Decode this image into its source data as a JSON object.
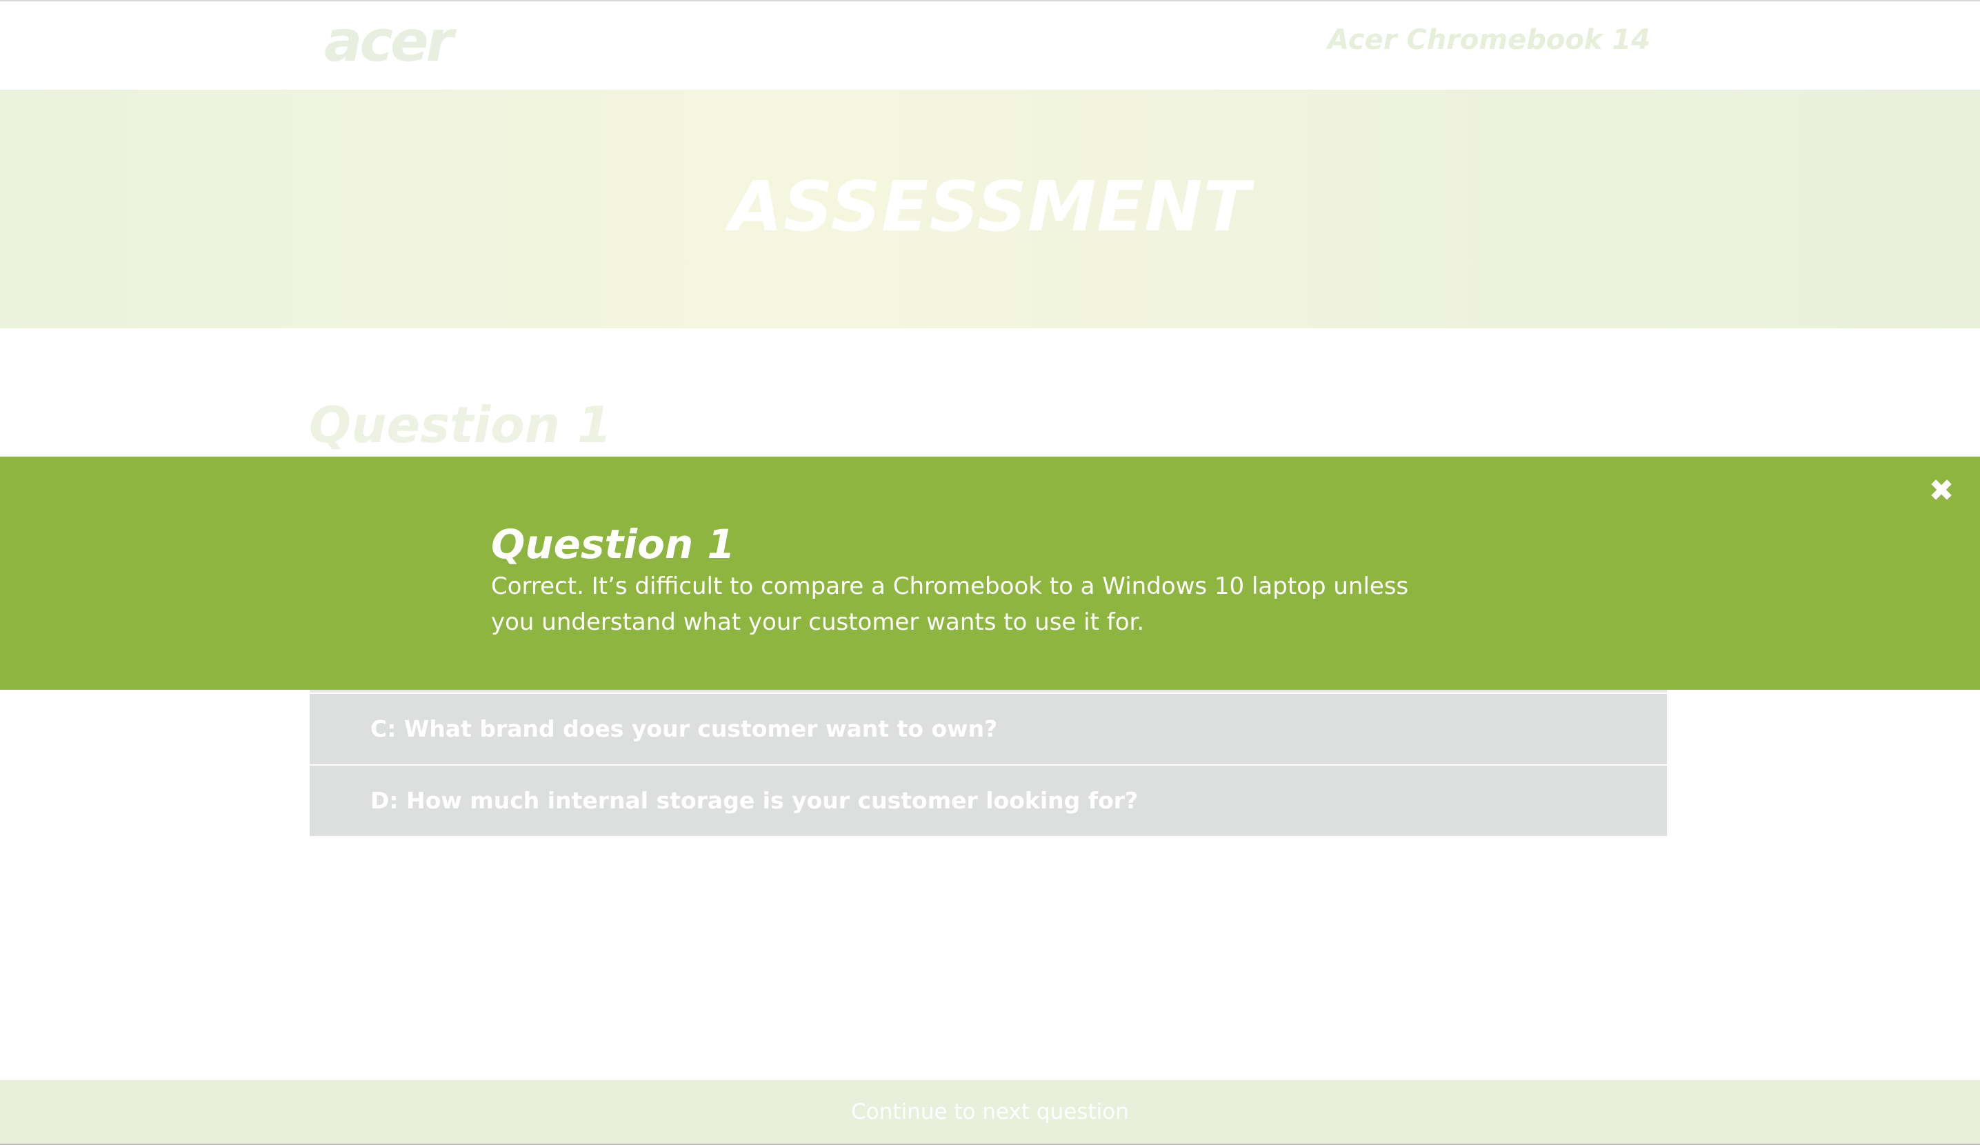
{
  "header": {
    "logo_text": "acer",
    "product_title": "Acer Chromebook 14"
  },
  "banner": {
    "title": "ASSESSMENT"
  },
  "question": {
    "heading": "Question 1",
    "options": [
      {
        "label": "C: What brand does your customer want to own?"
      },
      {
        "label": "D: How much internal storage is your customer looking for?"
      }
    ]
  },
  "feedback": {
    "title": "Question 1",
    "message": "Correct. It’s difficult to compare a Chromebook to a Windows 10 laptop unless you understand what your customer wants to use it for.",
    "close_icon": "close-icon",
    "close_glyph": "✖",
    "panel_color": "#8db540"
  },
  "footer": {
    "continue_label": "Continue to next question"
  }
}
